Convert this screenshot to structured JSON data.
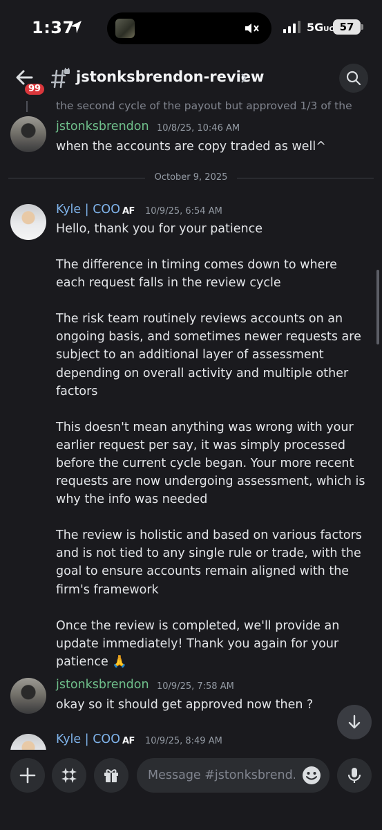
{
  "status_bar": {
    "time": "1:37",
    "network": "5G",
    "network_suffix": "UC",
    "battery": "57"
  },
  "header": {
    "channel_name": "jstonksbrendon-review",
    "unread_badge": "99"
  },
  "reply_preview": "the second cycle of the payout but approved 1/3 of the ...",
  "messages": [
    {
      "author": "jstonksbrendon",
      "timestamp": "10/8/25, 10:46 AM",
      "text": "when the accounts are copy traded as well^"
    },
    {
      "author": "Kyle | COO",
      "tag": "AF",
      "timestamp": "10/9/25, 6:54 AM",
      "paragraphs": [
        "Hello, thank you for your patience",
        "The difference in timing comes down to where each request falls in the review cycle",
        "The risk team routinely reviews accounts on an ongoing basis, and sometimes newer requests are subject to an additional layer of assessment depending on overall activity and multiple other factors",
        "This doesn't mean anything was wrong with your earlier request per say, it was simply processed before the current cycle began. Your more recent requests are now undergoing assessment, which is why the info was needed",
        "The review is holistic and based on various factors and is not tied to any single rule or trade, with the goal to ensure accounts remain aligned with the firm's framework",
        "Once the review is completed, we'll provide an update immediately! Thank you again for your patience 🙏"
      ]
    },
    {
      "author": "jstonksbrendon",
      "timestamp": "10/9/25, 7:58 AM",
      "text": "okay so it should get approved now then ?"
    },
    {
      "author": "Kyle | COO",
      "tag": "AF",
      "timestamp": "10/9/25, 8:49 AM"
    }
  ],
  "date_divider": "October 9, 2025",
  "composer": {
    "placeholder": "Message #jstonksbrend..."
  },
  "colors": {
    "background": "#1a1a1e",
    "author_green": "#6fbf8b",
    "author_blue": "#7fb3ea",
    "badge_red": "#da373c"
  }
}
